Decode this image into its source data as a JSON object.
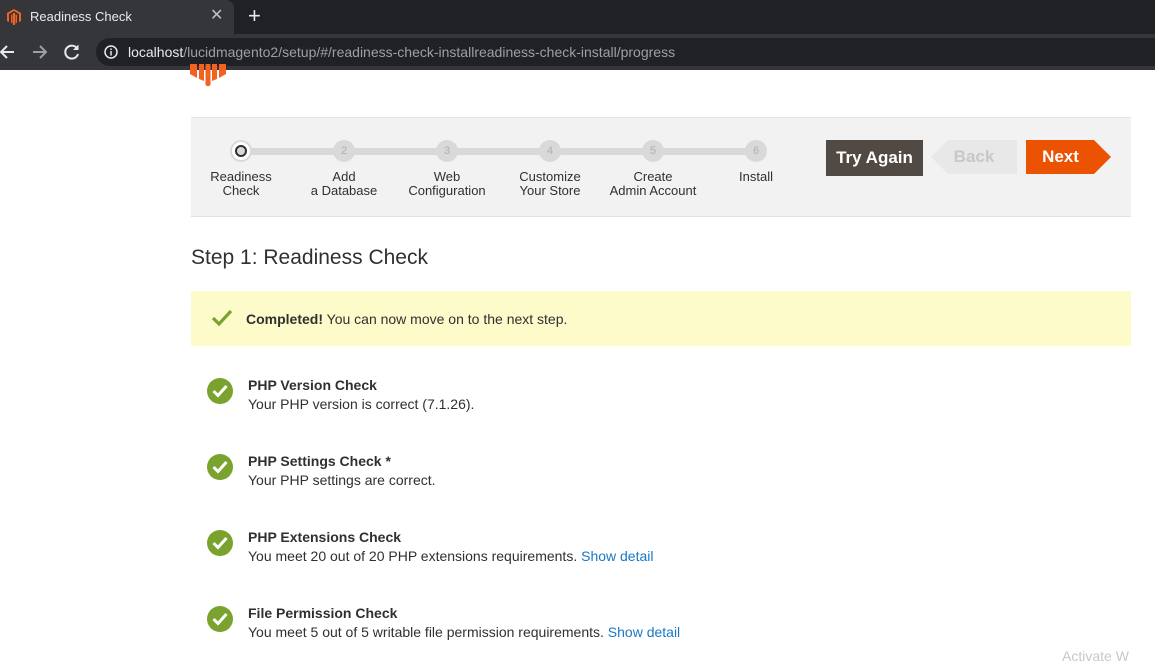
{
  "browser": {
    "tab_title": "Readiness Check",
    "close_glyph": "✕",
    "new_tab_glyph": "+",
    "url_host": "localhost",
    "url_path": "/lucidmagento2/setup/#/readiness-check-installreadiness-check-install/progress"
  },
  "wizard": {
    "steps": [
      {
        "number": "",
        "label_line1": "Readiness",
        "label_line2": "Check"
      },
      {
        "number": "2",
        "label_line1": "Add",
        "label_line2": "a Database"
      },
      {
        "number": "3",
        "label_line1": "Web",
        "label_line2": "Configuration"
      },
      {
        "number": "4",
        "label_line1": "Customize",
        "label_line2": "Your Store"
      },
      {
        "number": "5",
        "label_line1": "Create",
        "label_line2": "Admin Account"
      },
      {
        "number": "6",
        "label_line1": "Install",
        "label_line2": ""
      }
    ],
    "try_again_label": "Try Again",
    "back_label": "Back",
    "next_label": "Next"
  },
  "page": {
    "step_title": "Step 1: Readiness Check",
    "notice_bold": "Completed!",
    "notice_text": " You can now move on to the next step."
  },
  "checks": [
    {
      "title": "PHP Version Check",
      "desc": "Your PHP version is correct (7.1.26).",
      "link": ""
    },
    {
      "title": "PHP Settings Check *",
      "desc": "Your PHP settings are correct.",
      "link": ""
    },
    {
      "title": "PHP Extensions Check",
      "desc": "You meet 20 out of 20 PHP extensions requirements. ",
      "link": "Show detail"
    },
    {
      "title": "File Permission Check",
      "desc": "You meet 5 out of 5 writable file permission requirements. ",
      "link": "Show detail"
    }
  ],
  "overlay": {
    "watermark": "Activate W"
  },
  "colors": {
    "accent": "#eb5202",
    "success": "#79a22e",
    "link": "#1979c3",
    "notice_bg": "#fdfbca"
  },
  "icons": [
    "magento-favicon-icon",
    "close-icon",
    "plus-icon",
    "back-arrow-icon",
    "forward-arrow-icon",
    "reload-icon",
    "info-icon",
    "magento-logo-icon",
    "checkmark-icon",
    "check-circle-icon"
  ]
}
